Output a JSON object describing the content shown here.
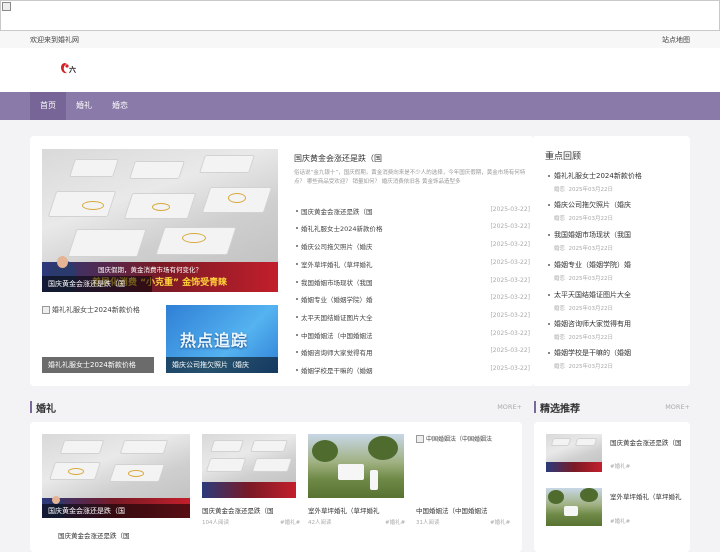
{
  "topbar": {
    "welcome": "欢迎来到婚礼网",
    "sitemap": "站点地图"
  },
  "nav": {
    "items": [
      "首页",
      "婚礼",
      "婚恋"
    ]
  },
  "colors": {
    "nav_bg": "#8a7aa9",
    "nav_active": "#776597",
    "accent": "#7a6a9c"
  },
  "featured": {
    "main_caption": "国庆黄金会涨还是跌（国",
    "main_overlay_line1": "国庆假期，黄金消费市场有何变化？",
    "main_overlay_line2": "差异化消费  “小克重”  金饰受青睐",
    "sub1_alt": "婚礼礼服女士2024新款价格",
    "sub1_caption": "婚礼礼服女士2024新款价格",
    "sub2_banner": "热点追踪",
    "sub2_caption": "婚庆公司拖欠照片（婚庆",
    "title": "国庆黄金会涨还是跌（国",
    "desc": "俗话说“金九银十”，国庆假期，黄金消费向来是不少人的选择，今年国庆假期，黄金市场有何特点？ 哪些商品受欢迎？ 销量如何？ 婚庆消费依旧各 黄金饰品造型多"
  },
  "news_list": [
    {
      "title": "国庆黄金会涨还是跌（国",
      "date": "[2025-03-22]"
    },
    {
      "title": "婚礼礼服女士2024新款价格",
      "date": "[2025-03-22]"
    },
    {
      "title": "婚庆公司拖欠照片（婚庆",
      "date": "[2025-03-22]"
    },
    {
      "title": "室外草坪婚礼（草坪婚礼",
      "date": "[2025-03-22]"
    },
    {
      "title": "我国婚姻市场现状（我国",
      "date": "[2025-03-22]"
    },
    {
      "title": "婚姻专业（婚姻学院）婚",
      "date": "[2025-03-22]"
    },
    {
      "title": "太平天国结婚证图片大全",
      "date": "[2025-03-22]"
    },
    {
      "title": "中国婚姻法（中国婚姻法",
      "date": "[2025-03-22]"
    },
    {
      "title": "婚姻咨询师大家觉得有用",
      "date": "[2025-03-22]"
    },
    {
      "title": "婚姻学校是干嘛的（婚姻",
      "date": "[2025-03-22]"
    }
  ],
  "recommend": {
    "title": "重点回顾",
    "items": [
      {
        "title": "婚礼礼服女士2024新款价格",
        "cat": "婚恋",
        "date": "2025年03月22日"
      },
      {
        "title": "婚庆公司拖欠照片（婚庆",
        "cat": "婚恋",
        "date": "2025年03月22日"
      },
      {
        "title": "我国婚姻市场现状（我国",
        "cat": "婚恋",
        "date": "2025年03月22日"
      },
      {
        "title": "婚姻专业（婚姻学院）婚",
        "cat": "婚恋",
        "date": "2025年03月22日"
      },
      {
        "title": "太平天国结婚证图片大全",
        "cat": "婚恋",
        "date": "2025年03月22日"
      },
      {
        "title": "婚姻咨询师大家觉得有用",
        "cat": "婚恋",
        "date": "2025年03月22日"
      },
      {
        "title": "婚姻学校是干嘛的（婚姻",
        "cat": "婚恋",
        "date": "2025年03月22日"
      }
    ]
  },
  "wedding_section": {
    "title": "婚礼",
    "more": "MORE+",
    "big_caption": "国庆黄金会涨还是跌（国",
    "big_list_first": "国庆黄金会涨还是跌（国",
    "cards": [
      {
        "title": "国庆黄金会涨还是跌（国",
        "views": "104人阅读",
        "tag": "#婚礼#"
      },
      {
        "title": "室外草坪婚礼（草坪婚礼",
        "views": "42人阅读",
        "tag": "#婚礼#"
      },
      {
        "title": "中国婚姻法（中国婚姻法",
        "views": "31人阅读",
        "tag": "#婚礼#",
        "alt": "中国婚姻法（中国婚姻法"
      }
    ]
  },
  "picks_section": {
    "title": "精选推荐",
    "more": "MORE+",
    "items": [
      {
        "title": "国庆黄金会涨还是跌（国",
        "tag": "#婚礼#"
      },
      {
        "title": "室外草坪婚礼（草坪婚礼",
        "tag": "#婚礼#"
      }
    ]
  }
}
